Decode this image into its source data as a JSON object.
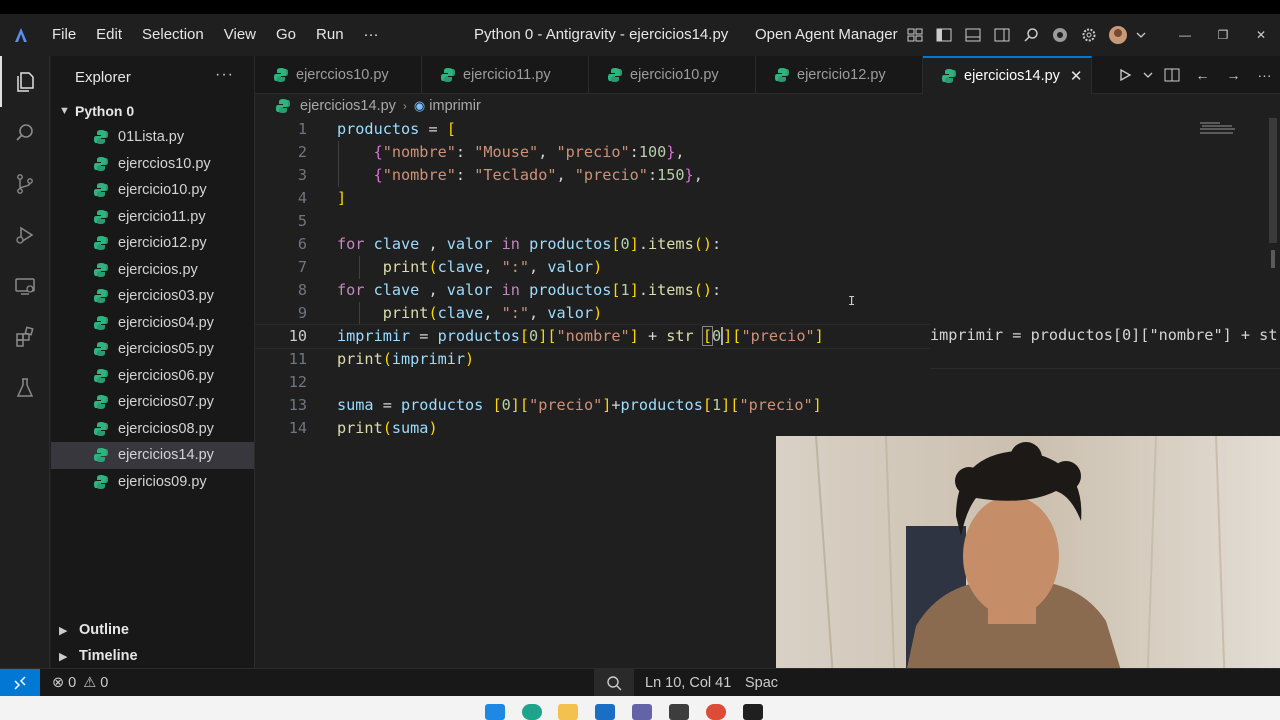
{
  "titlebar": {
    "menu": [
      "File",
      "Edit",
      "Selection",
      "View",
      "Go",
      "Run",
      "···"
    ],
    "window_title": "Python 0 - Antigravity - ejercicios14.py",
    "agent_manager": "Open Agent Manager"
  },
  "sidebar": {
    "title": "Explorer",
    "more": "···",
    "folder": "Python 0",
    "files": [
      "01Lista.py",
      "ejerccios10.py",
      "ejercicio10.py",
      "ejercicio11.py",
      "ejercicio12.py",
      "ejercicios.py",
      "ejercicios03.py",
      "ejercicios04.py",
      "ejercicios05.py",
      "ejercicios06.py",
      "ejercicios07.py",
      "ejercicios08.py",
      "ejercicios14.py",
      "ejericios09.py"
    ],
    "selected_file": "ejercicios14.py",
    "outline": "Outline",
    "timeline": "Timeline"
  },
  "tabs": [
    {
      "label": "ejerccios10.py",
      "active": false
    },
    {
      "label": "ejercicio11.py",
      "active": false
    },
    {
      "label": "ejercicio10.py",
      "active": false
    },
    {
      "label": "ejercicio12.py",
      "active": false
    },
    {
      "label": "ejercicios14.py",
      "active": true
    }
  ],
  "breadcrumb": {
    "file": "ejercicios14.py",
    "symbol": "imprimir"
  },
  "editor": {
    "line_numbers": [
      "1",
      "2",
      "3",
      "4",
      "5",
      "6",
      "7",
      "8",
      "9",
      "10",
      "11",
      "12",
      "13",
      "14"
    ],
    "current_line": "10",
    "ghost_text": "imprimir = productos[0][\"nombre\"] + st"
  },
  "statusbar": {
    "errors": "0",
    "warnings": "0",
    "position": "Ln 10, Col 41",
    "spaces": "Spac"
  },
  "colors": {
    "accent": "#0078d4",
    "python_icon": "#2fb37f",
    "keyword": "#c586c0",
    "string": "#ce9178",
    "variable": "#9cdcfe",
    "function": "#dcdcaa",
    "number": "#b5cea8"
  }
}
